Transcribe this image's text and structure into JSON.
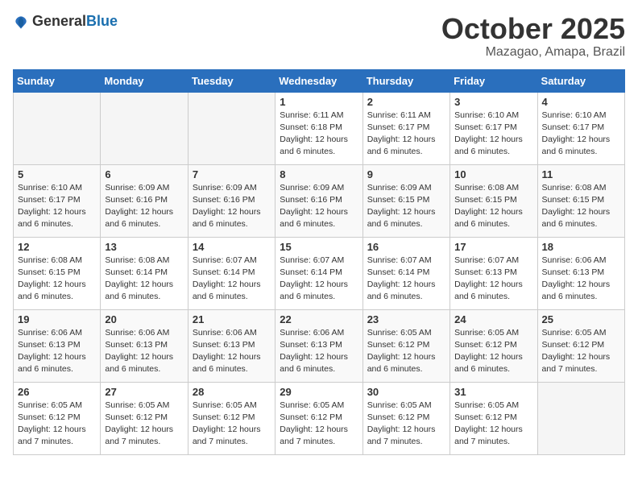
{
  "logo": {
    "general": "General",
    "blue": "Blue"
  },
  "header": {
    "month": "October 2025",
    "location": "Mazagao, Amapa, Brazil"
  },
  "days_of_week": [
    "Sunday",
    "Monday",
    "Tuesday",
    "Wednesday",
    "Thursday",
    "Friday",
    "Saturday"
  ],
  "weeks": [
    [
      {
        "day": "",
        "info": ""
      },
      {
        "day": "",
        "info": ""
      },
      {
        "day": "",
        "info": ""
      },
      {
        "day": "1",
        "info": "Sunrise: 6:11 AM\nSunset: 6:18 PM\nDaylight: 12 hours\nand 6 minutes."
      },
      {
        "day": "2",
        "info": "Sunrise: 6:11 AM\nSunset: 6:17 PM\nDaylight: 12 hours\nand 6 minutes."
      },
      {
        "day": "3",
        "info": "Sunrise: 6:10 AM\nSunset: 6:17 PM\nDaylight: 12 hours\nand 6 minutes."
      },
      {
        "day": "4",
        "info": "Sunrise: 6:10 AM\nSunset: 6:17 PM\nDaylight: 12 hours\nand 6 minutes."
      }
    ],
    [
      {
        "day": "5",
        "info": "Sunrise: 6:10 AM\nSunset: 6:17 PM\nDaylight: 12 hours\nand 6 minutes."
      },
      {
        "day": "6",
        "info": "Sunrise: 6:09 AM\nSunset: 6:16 PM\nDaylight: 12 hours\nand 6 minutes."
      },
      {
        "day": "7",
        "info": "Sunrise: 6:09 AM\nSunset: 6:16 PM\nDaylight: 12 hours\nand 6 minutes."
      },
      {
        "day": "8",
        "info": "Sunrise: 6:09 AM\nSunset: 6:16 PM\nDaylight: 12 hours\nand 6 minutes."
      },
      {
        "day": "9",
        "info": "Sunrise: 6:09 AM\nSunset: 6:15 PM\nDaylight: 12 hours\nand 6 minutes."
      },
      {
        "day": "10",
        "info": "Sunrise: 6:08 AM\nSunset: 6:15 PM\nDaylight: 12 hours\nand 6 minutes."
      },
      {
        "day": "11",
        "info": "Sunrise: 6:08 AM\nSunset: 6:15 PM\nDaylight: 12 hours\nand 6 minutes."
      }
    ],
    [
      {
        "day": "12",
        "info": "Sunrise: 6:08 AM\nSunset: 6:15 PM\nDaylight: 12 hours\nand 6 minutes."
      },
      {
        "day": "13",
        "info": "Sunrise: 6:08 AM\nSunset: 6:14 PM\nDaylight: 12 hours\nand 6 minutes."
      },
      {
        "day": "14",
        "info": "Sunrise: 6:07 AM\nSunset: 6:14 PM\nDaylight: 12 hours\nand 6 minutes."
      },
      {
        "day": "15",
        "info": "Sunrise: 6:07 AM\nSunset: 6:14 PM\nDaylight: 12 hours\nand 6 minutes."
      },
      {
        "day": "16",
        "info": "Sunrise: 6:07 AM\nSunset: 6:14 PM\nDaylight: 12 hours\nand 6 minutes."
      },
      {
        "day": "17",
        "info": "Sunrise: 6:07 AM\nSunset: 6:13 PM\nDaylight: 12 hours\nand 6 minutes."
      },
      {
        "day": "18",
        "info": "Sunrise: 6:06 AM\nSunset: 6:13 PM\nDaylight: 12 hours\nand 6 minutes."
      }
    ],
    [
      {
        "day": "19",
        "info": "Sunrise: 6:06 AM\nSunset: 6:13 PM\nDaylight: 12 hours\nand 6 minutes."
      },
      {
        "day": "20",
        "info": "Sunrise: 6:06 AM\nSunset: 6:13 PM\nDaylight: 12 hours\nand 6 minutes."
      },
      {
        "day": "21",
        "info": "Sunrise: 6:06 AM\nSunset: 6:13 PM\nDaylight: 12 hours\nand 6 minutes."
      },
      {
        "day": "22",
        "info": "Sunrise: 6:06 AM\nSunset: 6:13 PM\nDaylight: 12 hours\nand 6 minutes."
      },
      {
        "day": "23",
        "info": "Sunrise: 6:05 AM\nSunset: 6:12 PM\nDaylight: 12 hours\nand 6 minutes."
      },
      {
        "day": "24",
        "info": "Sunrise: 6:05 AM\nSunset: 6:12 PM\nDaylight: 12 hours\nand 6 minutes."
      },
      {
        "day": "25",
        "info": "Sunrise: 6:05 AM\nSunset: 6:12 PM\nDaylight: 12 hours\nand 7 minutes."
      }
    ],
    [
      {
        "day": "26",
        "info": "Sunrise: 6:05 AM\nSunset: 6:12 PM\nDaylight: 12 hours\nand 7 minutes."
      },
      {
        "day": "27",
        "info": "Sunrise: 6:05 AM\nSunset: 6:12 PM\nDaylight: 12 hours\nand 7 minutes."
      },
      {
        "day": "28",
        "info": "Sunrise: 6:05 AM\nSunset: 6:12 PM\nDaylight: 12 hours\nand 7 minutes."
      },
      {
        "day": "29",
        "info": "Sunrise: 6:05 AM\nSunset: 6:12 PM\nDaylight: 12 hours\nand 7 minutes."
      },
      {
        "day": "30",
        "info": "Sunrise: 6:05 AM\nSunset: 6:12 PM\nDaylight: 12 hours\nand 7 minutes."
      },
      {
        "day": "31",
        "info": "Sunrise: 6:05 AM\nSunset: 6:12 PM\nDaylight: 12 hours\nand 7 minutes."
      },
      {
        "day": "",
        "info": ""
      }
    ]
  ]
}
